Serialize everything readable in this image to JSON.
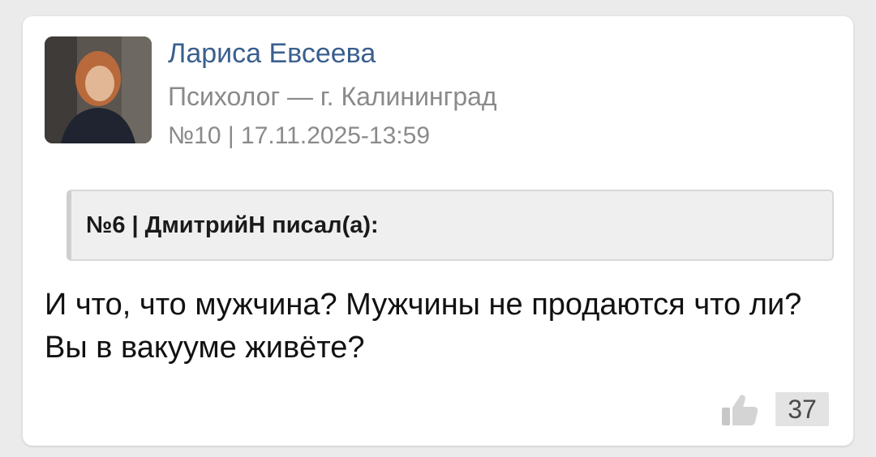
{
  "post": {
    "author": {
      "name": "Лариса Евсеева",
      "role": "Психолог — г. Калининград"
    },
    "meta": "№10 | 17.11.2025-13:59",
    "quote": {
      "header": "№6 | ДмитрийН писал(а):"
    },
    "body": "И что, что мужчина? Мужчины не продаются что ли? Вы в вакууме живёте?",
    "likes": {
      "icon": "thumbs-up-icon",
      "count": "37"
    }
  },
  "colors": {
    "author_link": "#3a5f8f",
    "muted_text": "#8a8a8a",
    "quote_bg": "#efefef",
    "page_bg": "#ebebeb"
  }
}
